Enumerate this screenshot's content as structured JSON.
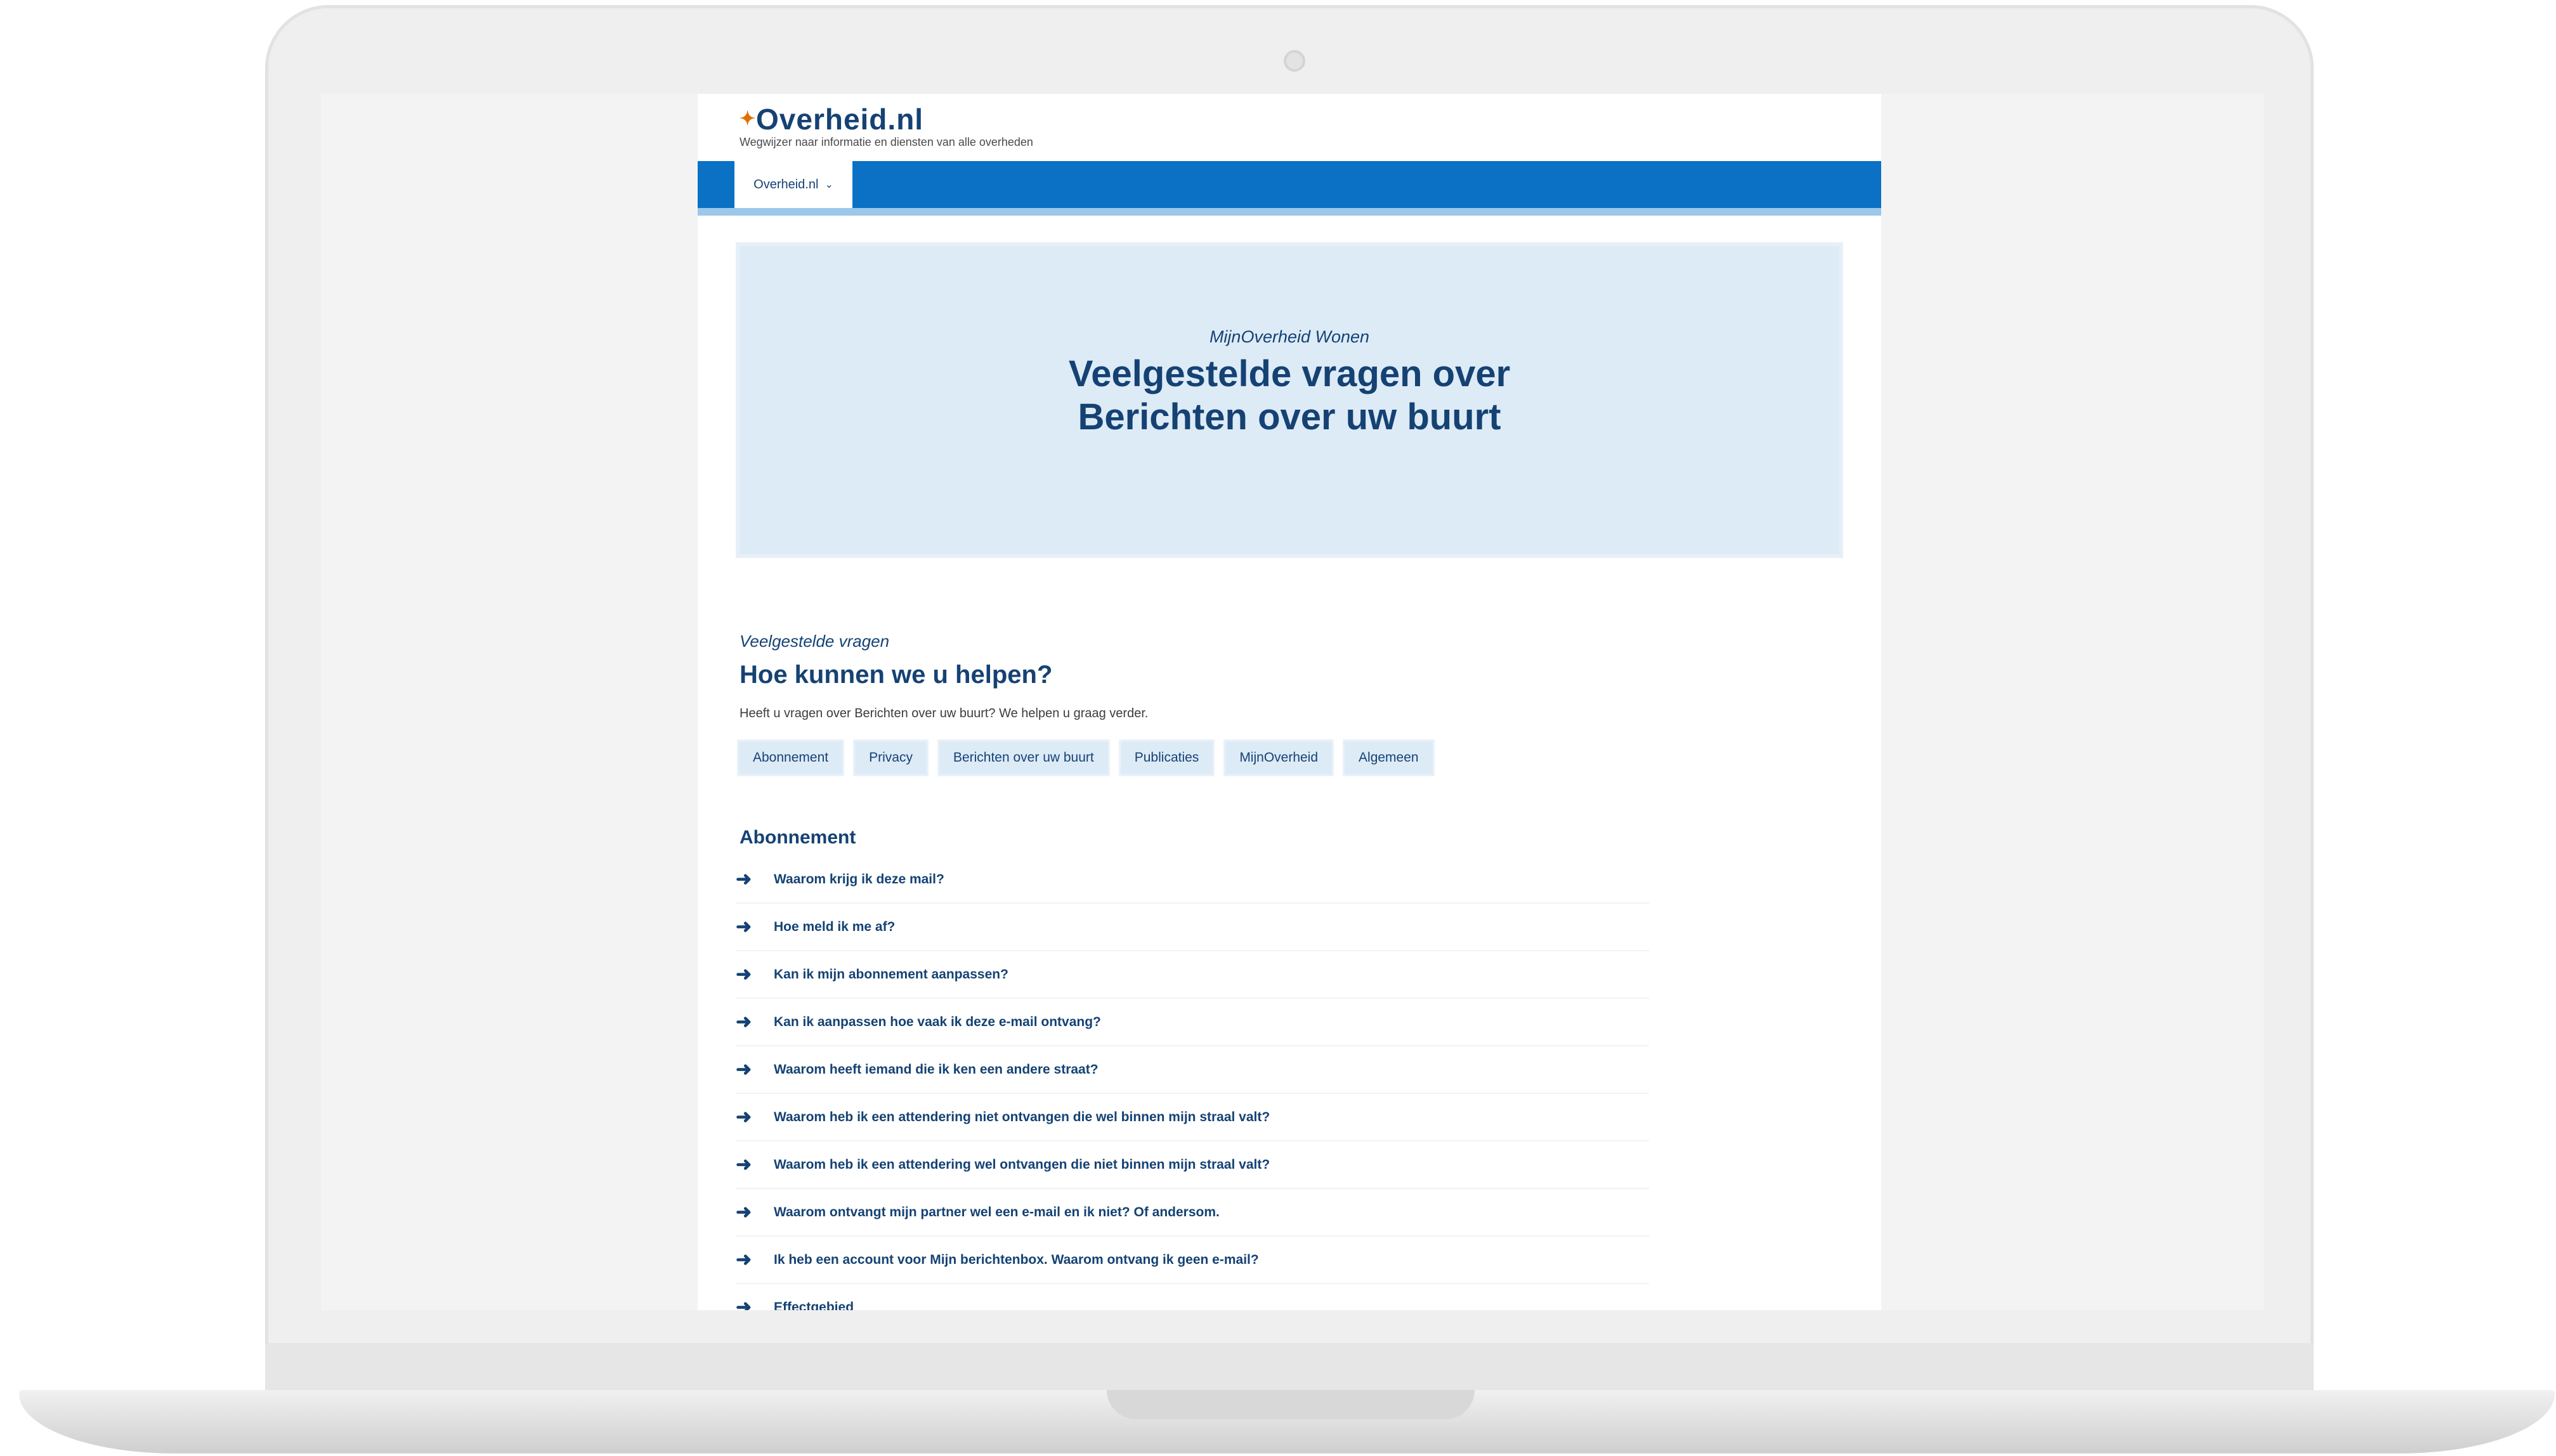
{
  "colors": {
    "brand_blue": "#154273",
    "nav_blue": "#0b71c4",
    "hero_bg": "#ddebf7",
    "logo_accent": "#e17000"
  },
  "header": {
    "logo_text": "Overheid.nl",
    "logo_icon": "crown-spark-icon",
    "tagline": "Wegwijzer naar informatie en diensten van alle overheden"
  },
  "nav": {
    "dropdown_label": "Overheid.nl",
    "dropdown_icon": "chevron-down-icon"
  },
  "hero": {
    "eyebrow": "MijnOverheid Wonen",
    "title_line1": "Veelgestelde vragen over",
    "title_line2": "Berichten over uw buurt"
  },
  "faq": {
    "eyebrow": "Veelgestelde vragen",
    "title": "Hoe kunnen we u helpen?",
    "intro": "Heeft u vragen over Berichten over uw buurt? We helpen u graag verder.",
    "tags": [
      "Abonnement",
      "Privacy",
      "Berichten over uw buurt",
      "Publicaties",
      "MijnOverheid",
      "Algemeen"
    ],
    "section_title": "Abonnement",
    "arrow_icon": "arrow-right-icon",
    "items": [
      "Waarom krijg ik deze mail?",
      "Hoe meld ik me af?",
      "Kan ik mijn abonnement aanpassen?",
      "Kan ik aanpassen hoe vaak ik deze e-mail ontvang?",
      "Waarom heeft iemand die ik ken een andere straat?",
      "Waarom heb ik een attendering niet ontvangen die wel binnen mijn straal valt?",
      "Waarom heb ik een attendering wel ontvangen die niet binnen mijn straal valt?",
      "Waarom ontvangt mijn partner wel een e-mail en ik niet? Of andersom.",
      "Ik heb een account voor Mijn berichtenbox. Waarom ontvang ik geen e-mail?",
      "Effectgebied"
    ]
  }
}
